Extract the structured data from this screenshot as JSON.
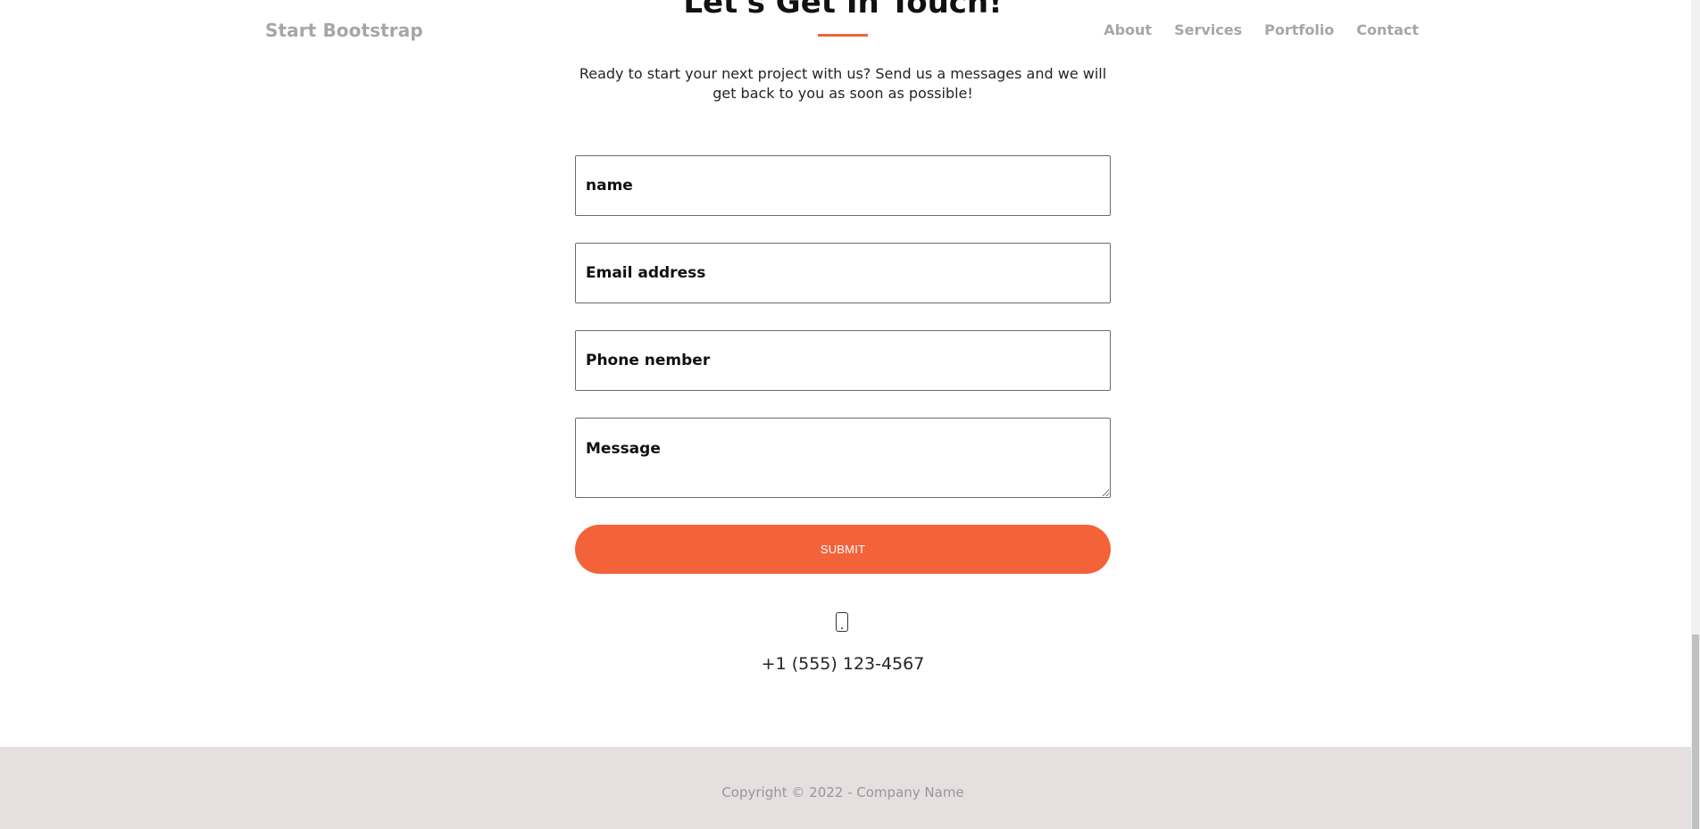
{
  "navbar": {
    "brand": "Start Bootstrap",
    "links": [
      "About",
      "Services",
      "Portfolio",
      "Contact"
    ]
  },
  "contact": {
    "heading": "Let's Get In Touch!",
    "lead": "Ready to start your next project with us? Send us a messages and we will get back to you as soon as possible!",
    "form": {
      "name_placeholder": "name",
      "email_placeholder": "Email address",
      "phone_placeholder": "Phone nember",
      "message_placeholder": "Message",
      "submit_label": "SUBMIT"
    },
    "phone_icon": "mobile-phone-icon",
    "phone_number": "+1 (555) 123-4567"
  },
  "footer": {
    "copyright": "Copyright © 2022 - Company Name"
  },
  "colors": {
    "accent": "#f4623a",
    "footer_bg": "#e6dfe0",
    "nav_text": "#a8a5a6"
  }
}
